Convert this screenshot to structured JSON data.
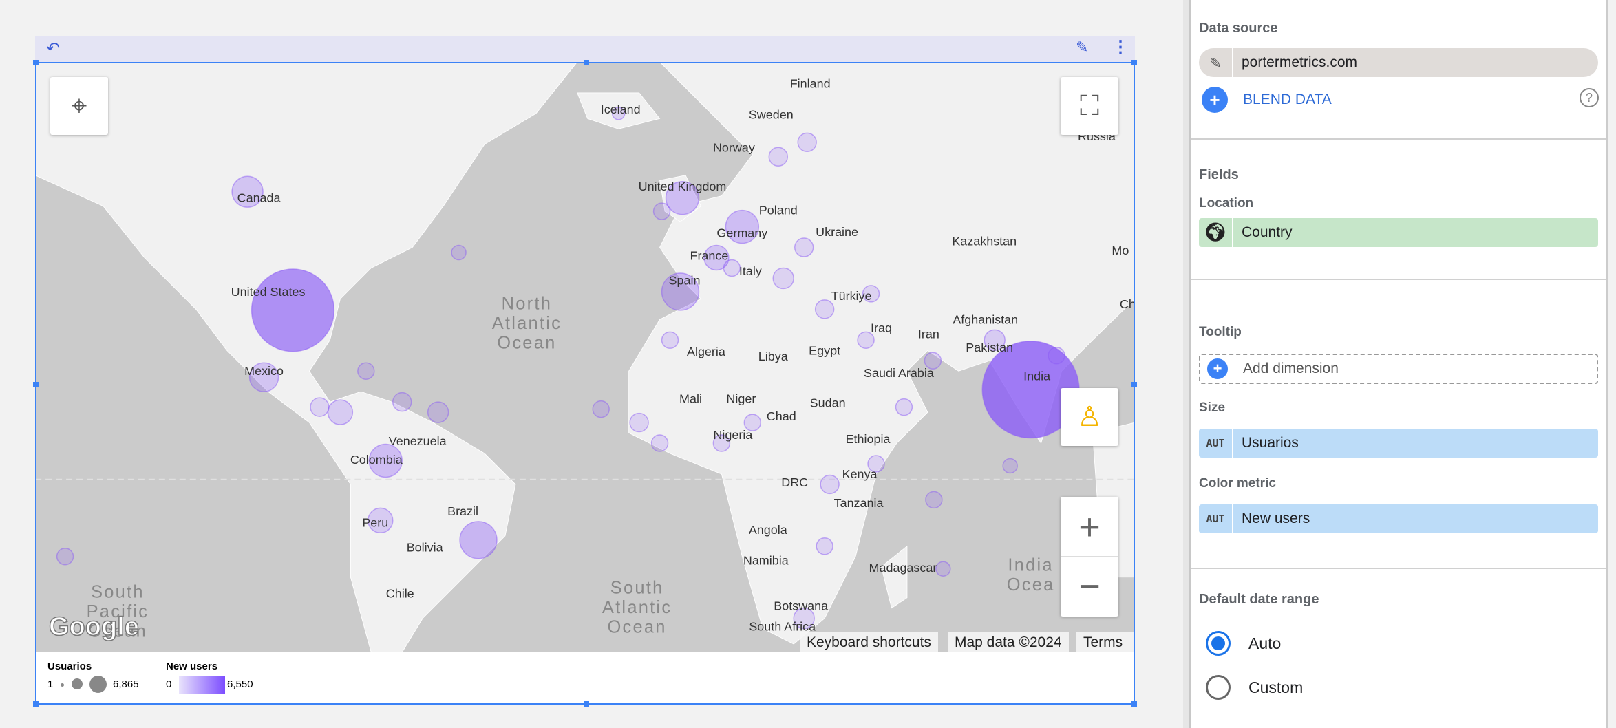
{
  "toolbar": {
    "undo_icon": "undo-icon",
    "edit_icon": "pencil-icon",
    "more_icon": "more-vert-icon"
  },
  "map": {
    "country_labels": [
      "Finland",
      "Iceland",
      "Sweden",
      "Norway",
      "Russia",
      "Canada",
      "United Kingdom",
      "Poland",
      "Germany",
      "Ukraine",
      "Kazakhstan",
      "France",
      "Italy",
      "Spain",
      "Türkiye",
      "United States",
      "Afghanistan",
      "Iraq",
      "Iran",
      "Pakistan",
      "Mexico",
      "Algeria",
      "Libya",
      "Egypt",
      "Saudi Arabia",
      "India",
      "Mali",
      "Niger",
      "Sudan",
      "Chad",
      "Venezuela",
      "Colombia",
      "Nigeria",
      "Ethiopia",
      "Kenya",
      "DRC",
      "Tanzania",
      "Brazil",
      "Peru",
      "Bolivia",
      "Angola",
      "Namibia",
      "Madagascar",
      "Botswana",
      "Chile",
      "South Africa",
      "Mo",
      "Ch"
    ],
    "ocean_labels": [
      [
        "North",
        "Atlantic",
        "Ocean"
      ],
      [
        "South",
        "Atlantic",
        "Ocean"
      ],
      [
        "South",
        "Pacific",
        "Ocean"
      ],
      [
        "India",
        "Ocea"
      ]
    ],
    "logo": "Google",
    "attribution": {
      "shortcuts": "Keyboard shortcuts",
      "map_data": "Map data ©2024",
      "terms": "Terms"
    },
    "zoom_in": "+",
    "zoom_out": "−",
    "bubble_color": "#8b5cf6"
  },
  "legend": {
    "size": {
      "title": "Usuarios",
      "min": "1",
      "max": "6,865"
    },
    "color": {
      "title": "New users",
      "min": "0",
      "max": "6,550",
      "color_from": "#e9e3fc",
      "color_to": "#7c4dff"
    }
  },
  "panel": {
    "data_source": {
      "title": "Data source",
      "value": "portermetrics.com",
      "blend": "BLEND DATA"
    },
    "fields": {
      "title": "Fields",
      "location_label": "Location",
      "location_value": "Country"
    },
    "tooltip": {
      "title": "Tooltip",
      "add": "Add dimension"
    },
    "size": {
      "label": "Size",
      "type": "AUT",
      "value": "Usuarios"
    },
    "color_metric": {
      "label": "Color metric",
      "type": "AUT",
      "value": "New users"
    },
    "date_range": {
      "title": "Default date range",
      "options": [
        "Auto",
        "Custom"
      ],
      "selected": "Auto"
    },
    "accent": "#3b82f6"
  }
}
